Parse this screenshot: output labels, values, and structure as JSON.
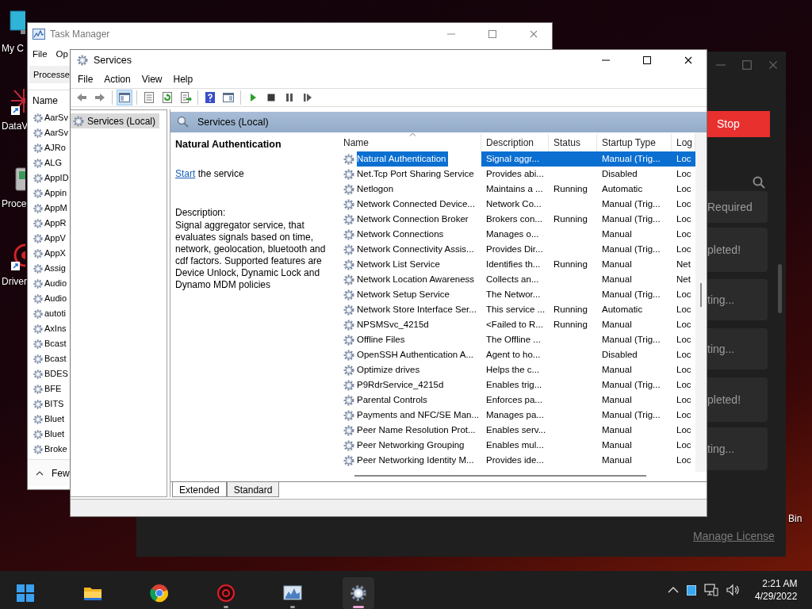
{
  "desktop_icons": [
    {
      "label": "My C",
      "kind": "monitor"
    },
    {
      "label": "DataV",
      "kind": "datav"
    },
    {
      "label": "Proce",
      "kind": "device"
    },
    {
      "label": "Driver",
      "kind": "driver"
    }
  ],
  "recycle_label": "Bin",
  "task_manager": {
    "title": "Task Manager",
    "menu": [
      "File",
      "Op"
    ],
    "tab": "Processe",
    "column": "Name",
    "rows": [
      "AarSv",
      "AarSv",
      "AJRo",
      "ALG",
      "AppID",
      "Appin",
      "AppM",
      "AppR",
      "AppV",
      "AppX",
      "Assig",
      "Audio",
      "Audio",
      "autoti",
      "AxIns",
      "Bcast",
      "Bcast",
      "BDES",
      "BFE",
      "BITS",
      "Bluet",
      "Bluet",
      "Broke"
    ],
    "footer": "Few"
  },
  "dark_app": {
    "stop_button": "Stop",
    "cards": [
      "Required",
      "pleted!",
      "ting...",
      "ting...",
      "pleted!",
      "ting..."
    ],
    "link": "Manage License"
  },
  "services": {
    "title": "Services",
    "menu": [
      "File",
      "Action",
      "View",
      "Help"
    ],
    "toolbar": [
      [
        {
          "kind": "back"
        },
        {
          "kind": "forward"
        }
      ],
      [
        {
          "kind": "tree"
        }
      ],
      [
        {
          "kind": "properties"
        },
        {
          "kind": "refresh"
        },
        {
          "kind": "export"
        }
      ],
      [
        {
          "kind": "help"
        },
        {
          "kind": "pane"
        }
      ],
      [
        {
          "kind": "play"
        },
        {
          "kind": "stop"
        },
        {
          "kind": "pause"
        },
        {
          "kind": "resume"
        }
      ]
    ],
    "tree": [
      {
        "label": "Services (Local)",
        "selected": true
      }
    ],
    "pane_title": "Services (Local)",
    "detail": {
      "name": "Natural Authentication",
      "action_link": "Start",
      "action_rest": " the service",
      "description_label": "Description:",
      "description": "Signal aggregator service, that evaluates signals based on time, network, geolocation, bluetooth and cdf factors. Supported features are Device Unlock, Dynamic Lock and Dynamo MDM policies"
    },
    "columns": [
      "Name",
      "Description",
      "Status",
      "Startup Type",
      "Log"
    ],
    "rows": [
      {
        "name": "Natural Authentication",
        "description": "Signal aggr...",
        "startup": "Manual (Trig...",
        "log": "Loc",
        "selected": true
      },
      {
        "name": "Net.Tcp Port Sharing Service",
        "description": "Provides abi...",
        "startup": "Disabled",
        "log": "Loc",
        "selected": false
      },
      {
        "name": "Netlogon",
        "description": "Maintains a ...",
        "status": "Running",
        "startup": "Automatic",
        "log": "Loc",
        "selected": false
      },
      {
        "name": "Network Connected Device...",
        "description": "Network Co...",
        "startup": "Manual (Trig...",
        "log": "Loc",
        "selected": false
      },
      {
        "name": "Network Connection Broker",
        "description": "Brokers con...",
        "status": "Running",
        "startup": "Manual (Trig...",
        "log": "Loc",
        "selected": false
      },
      {
        "name": "Network Connections",
        "description": "Manages o...",
        "startup": "Manual",
        "log": "Loc",
        "selected": false
      },
      {
        "name": "Network Connectivity Assis...",
        "description": "Provides Dir...",
        "startup": "Manual (Trig...",
        "log": "Loc",
        "selected": false
      },
      {
        "name": "Network List Service",
        "description": "Identifies th...",
        "status": "Running",
        "startup": "Manual",
        "log": "Net",
        "selected": false
      },
      {
        "name": "Network Location Awareness",
        "description": "Collects an...",
        "startup": "Manual",
        "log": "Net",
        "selected": false
      },
      {
        "name": "Network Setup Service",
        "description": "The Networ...",
        "startup": "Manual (Trig...",
        "log": "Loc",
        "selected": false
      },
      {
        "name": "Network Store Interface Ser...",
        "description": "This service ...",
        "status": "Running",
        "startup": "Automatic",
        "log": "Loc",
        "selected": false
      },
      {
        "name": "NPSMSvc_4215d",
        "description": "<Failed to R...",
        "status": "Running",
        "startup": "Manual",
        "log": "Loc",
        "selected": false
      },
      {
        "name": "Offline Files",
        "description": "The Offline ...",
        "startup": "Manual (Trig...",
        "log": "Loc",
        "selected": false
      },
      {
        "name": "OpenSSH Authentication A...",
        "description": "Agent to ho...",
        "startup": "Disabled",
        "log": "Loc",
        "selected": false
      },
      {
        "name": "Optimize drives",
        "description": "Helps the c...",
        "startup": "Manual",
        "log": "Loc",
        "selected": false
      },
      {
        "name": "P9RdrService_4215d",
        "description": "Enables trig...",
        "startup": "Manual (Trig...",
        "log": "Loc",
        "selected": false
      },
      {
        "name": "Parental Controls",
        "description": "Enforces pa...",
        "startup": "Manual",
        "log": "Loc",
        "selected": false
      },
      {
        "name": "Payments and NFC/SE Man...",
        "description": "Manages pa...",
        "startup": "Manual (Trig...",
        "log": "Loc",
        "selected": false
      },
      {
        "name": "Peer Name Resolution Prot...",
        "description": "Enables serv...",
        "startup": "Manual",
        "log": "Loc",
        "selected": false
      },
      {
        "name": "Peer Networking Grouping",
        "description": "Enables mul...",
        "startup": "Manual",
        "log": "Loc",
        "selected": false
      },
      {
        "name": "Peer Networking Identity M...",
        "description": "Provides ide...",
        "startup": "Manual",
        "log": "Loc",
        "selected": false
      }
    ],
    "tabs": [
      {
        "label": "Extended",
        "selected": true
      },
      {
        "label": "Standard",
        "selected": false
      }
    ]
  },
  "taskbar": {
    "apps": [
      {
        "kind": "start",
        "running": false,
        "selected": false
      },
      {
        "kind": "folder",
        "running": false,
        "selected": false
      },
      {
        "kind": "browser",
        "running": false,
        "selected": false
      },
      {
        "kind": "driver",
        "running": true,
        "selected": false
      },
      {
        "kind": "monitor",
        "running": true,
        "selected": false
      },
      {
        "kind": "gear",
        "running": true,
        "selected": true
      }
    ],
    "time": "2:21 AM",
    "date": "4/29/2022"
  }
}
